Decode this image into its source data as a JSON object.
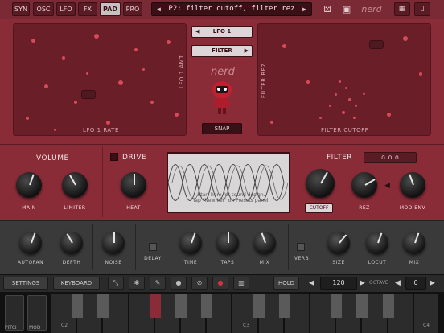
{
  "topbar": {
    "tabs": [
      "SYN",
      "OSC",
      "LFO",
      "FX",
      "PAD",
      "PRO"
    ],
    "active_tab": "PAD",
    "preset_name": "P2: filter cutoff, filter rez",
    "brand": "nerd"
  },
  "pads": {
    "left_x_label": "LFO 1 RATE",
    "left_y_label": "LFO 1 AMT",
    "right_x_label": "FILTER CUTOFF",
    "right_y_label": "FILTER REZ",
    "left_assign": "LFO 1",
    "right_assign": "FILTER",
    "snap_label": "SNAP",
    "logo": "nerd"
  },
  "middle": {
    "volume_label": "VOLUME",
    "main_label": "MAIN",
    "limiter_label": "LIMITER",
    "drive_label": "DRIVE",
    "heat_label": "HEAT",
    "scope_text_1": "Start here for sound design.",
    "scope_text_2": "Tap \"New Init\" on Presets panel.",
    "filter_label": "FILTER",
    "filter_shapes": "∩ ∩ ∩",
    "cutoff_label": "CUTOFF",
    "rez_label": "REZ",
    "modenv_label": "MOD ENV"
  },
  "lower": {
    "autopan": "AUTOPAN",
    "depth": "DEPTH",
    "noise": "NOISE",
    "delay": "DELAY",
    "time": "TIME",
    "taps": "TAPS",
    "mix1": "MIX",
    "verb": "VERB",
    "size": "SIZE",
    "locut": "LOCUT",
    "mix2": "MIX"
  },
  "toolbar": {
    "settings": "SETTINGS",
    "keyboard": "KEYBOARD",
    "hold": "HOLD",
    "tempo": "120",
    "octave_label": "OCTAVE",
    "octave_value": "0"
  },
  "keyboard": {
    "pitch_label": "PITCH",
    "mod_label": "MOD",
    "octave_labels": [
      "C2",
      "C3",
      "C4"
    ]
  },
  "colors": {
    "accent": "#8a2c38",
    "dark_panel": "#3a3a3a",
    "dots": "#d64a5a"
  }
}
